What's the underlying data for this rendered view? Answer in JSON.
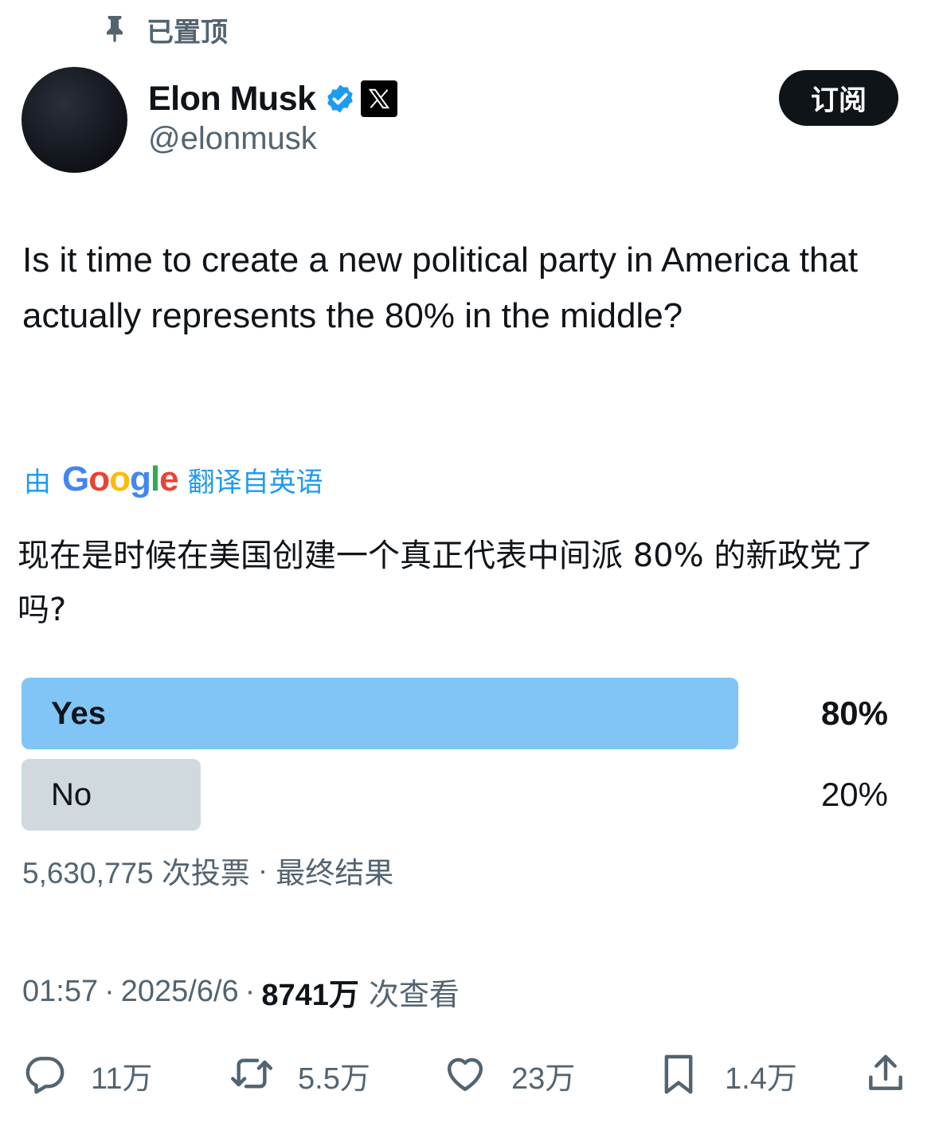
{
  "pinned": {
    "label": "已置顶"
  },
  "author": {
    "name": "Elon Musk",
    "handle": "@elonmusk"
  },
  "subscribe_label": "订阅",
  "tweet": {
    "text": "Is it time to create a new political party in America that actually represents the 80% in the middle?"
  },
  "translation": {
    "by": "由",
    "provider": "Google",
    "from": "翻译自英语",
    "text": "现在是时候在美国创建一个真正代表中间派 80% 的新政党了吗?"
  },
  "poll": {
    "options": [
      {
        "label": "Yes",
        "percent_text": "80%",
        "percent": 80,
        "winner": true
      },
      {
        "label": "No",
        "percent_text": "20%",
        "percent": 20,
        "winner": false
      }
    ],
    "votes": "5,630,775 次投票",
    "separator": "·",
    "status": "最终结果"
  },
  "meta": {
    "time": "01:57",
    "date": "2025/6/6",
    "views": "8741万",
    "views_label": "次查看",
    "separator": "·"
  },
  "actions": {
    "reply_count": "11万",
    "retweet_count": "5.5万",
    "like_count": "23万",
    "bookmark_count": "1.4万"
  },
  "colors": {
    "winner_bar": "#80c5f6",
    "loser_bar": "#cfd9de",
    "link_blue": "#1d9bf0",
    "muted_text": "#536471"
  },
  "icons": [
    "pin-icon",
    "verified-badge-icon",
    "x-logo-icon",
    "reply-icon",
    "retweet-icon",
    "like-icon",
    "bookmark-icon",
    "share-icon"
  ]
}
